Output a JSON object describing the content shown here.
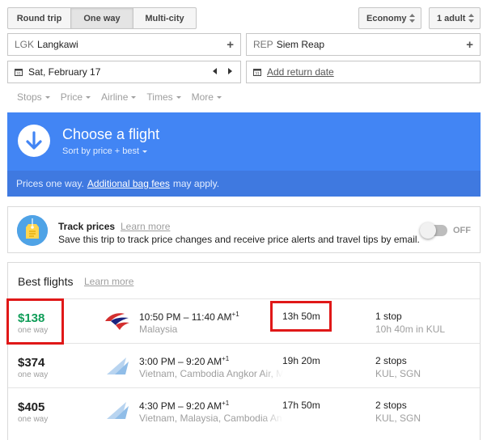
{
  "trip_types": [
    {
      "label": "Round trip",
      "active": false
    },
    {
      "label": "One way",
      "active": true
    },
    {
      "label": "Multi-city",
      "active": false
    }
  ],
  "cabin_class": "Economy",
  "passengers": "1 adult",
  "origin": {
    "code": "LGK",
    "city": "Langkawi"
  },
  "destination": {
    "code": "REP",
    "city": "Siem Reap"
  },
  "depart_date": "Sat, February 17",
  "return_date_placeholder": "Add return date",
  "filters": [
    "Stops",
    "Price",
    "Airline",
    "Times",
    "More"
  ],
  "banner": {
    "title": "Choose a flight",
    "sort": "Sort by price + best",
    "footer_prefix": "Prices one way.",
    "footer_link": "Additional bag fees",
    "footer_suffix": "may apply."
  },
  "track_prices": {
    "title": "Track prices",
    "learn_more": "Learn more",
    "description": "Save this trip to track price changes and receive price alerts and travel tips by email.",
    "toggle_state": "OFF"
  },
  "best_flights": {
    "title": "Best flights",
    "learn_more": "Learn more",
    "flights": [
      {
        "price": "$138",
        "price_note": "one way",
        "times": "10:50 PM – 11:40 AM",
        "day_offset": "+1",
        "airline": "Malaysia",
        "duration": "13h 50m",
        "stops": "1 stop",
        "stop_detail": "10h 40m in KUL",
        "cheapest": true
      },
      {
        "price": "$374",
        "price_note": "one way",
        "times": "3:00 PM – 9:20 AM",
        "day_offset": "+1",
        "airline": "Vietnam, Cambodia Angkor Air, M",
        "duration": "19h 20m",
        "stops": "2 stops",
        "stop_detail": "KUL, SGN",
        "cheapest": false
      },
      {
        "price": "$405",
        "price_note": "one way",
        "times": "4:30 PM – 9:20 AM",
        "day_offset": "+1",
        "airline": "Vietnam, Malaysia, Cambodia An",
        "duration": "17h 50m",
        "stops": "2 stops",
        "stop_detail": "KUL, SGN",
        "cheapest": false
      }
    ]
  },
  "colors": {
    "accent_blue": "#4285f4",
    "cheap_green": "#0f9d58",
    "highlight_red": "#e01818"
  }
}
